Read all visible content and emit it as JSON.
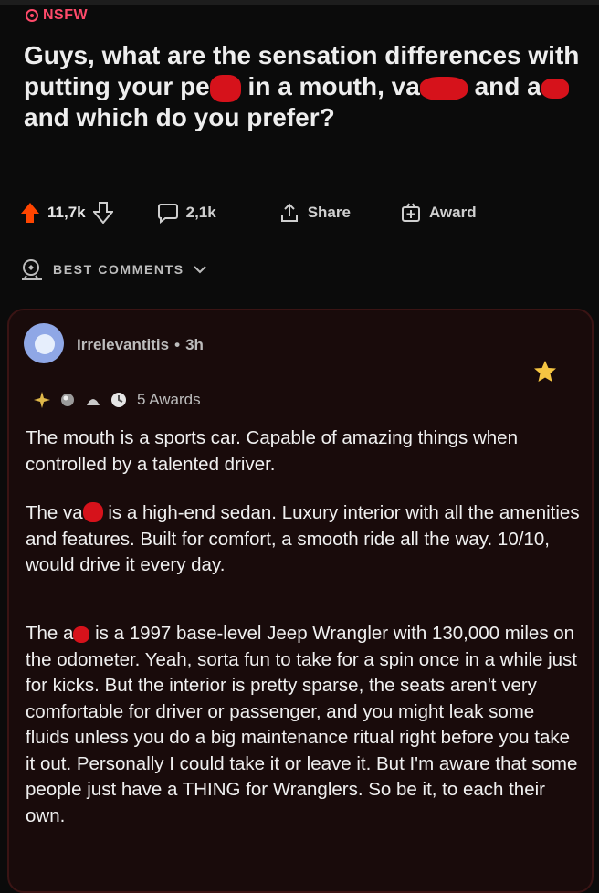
{
  "post": {
    "nsfw_label": "NSFW",
    "title_parts": [
      "Guys, what are the sensation differences with putting your pe",
      "in a mouth, va",
      "and a",
      "and which do you prefer?"
    ],
    "upvotes": "11,7k",
    "comments": "2,1k",
    "share_label": "Share",
    "award_label": "Award"
  },
  "sort": {
    "label": "BEST COMMENTS"
  },
  "comment": {
    "author": "Irrelevantitis",
    "separator": "•",
    "age": "3h",
    "awards_count": "5 Awards",
    "paragraphs": [
      "The mouth is a sports car. Capable of amazing things when controlled by a talented driver.",
      "is a high-end sedan. Luxury interior with all the amenities and features. Built for comfort, a smooth ride all the way.  10/10, would drive it every day.",
      "is a 1997 base-level Jeep Wrangler with 130,000 miles on the odometer. Yeah, sorta fun to take for a spin once in a while just for kicks. But the interior is pretty sparse, the seats aren't very comfortable for driver or passenger, and you might leak some fluids unless you do a big maintenance ritual right before you take it out. Personally I could take it or leave it. But I'm aware that some people just have a THING for Wranglers. So be it, to each their own."
    ],
    "para2_lead": "The va",
    "para3_lead": "The a"
  },
  "colors": {
    "nsfw": "#ff4a6a",
    "upvote": "#ff4500",
    "redaction": "#d6121b",
    "comment_bg": "#190b0b"
  },
  "icons": [
    "nsfw-icon",
    "upvote-icon",
    "downvote-icon",
    "comment-icon",
    "share-icon",
    "award-icon",
    "shield-icon",
    "chevron-down-icon",
    "star-icon"
  ]
}
